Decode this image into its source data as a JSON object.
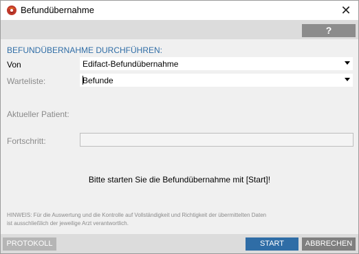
{
  "window": {
    "title": "Befundübernahme",
    "icon": "app-logo-icon",
    "close_glyph": "✕"
  },
  "toolbar": {
    "help_label": "?"
  },
  "form": {
    "section_title": "BEFUNDÜBERNAHME DURCHFÜHREN:",
    "von_label": "Von",
    "von_value": "Edifact-Befundübernahme",
    "warteliste_label": "Warteliste:",
    "warteliste_value": "Befunde",
    "patient_label": "Aktueller Patient:",
    "patient_value": "",
    "fortschritt_label": "Fortschritt:",
    "fortschritt_value": 0
  },
  "message": "Bitte starten Sie die Befundübernahme mit [Start]!",
  "hint": {
    "line1": "HINWEIS: Für die Auswertung und die Kontrolle auf Vollständigkeit und Richtigkeit der übermittelten Daten",
    "line2": "ist ausschließlich der jeweilige Arzt verantwortlich."
  },
  "buttons": {
    "protokoll": "PROTOKOLL",
    "start": "START",
    "abbrechen": "ABBRECHEN"
  },
  "colors": {
    "accent": "#2f6da6",
    "button_grey": "#7f7f7f",
    "button_disabled": "#b5b5b5",
    "strip": "#dcdcdc"
  }
}
